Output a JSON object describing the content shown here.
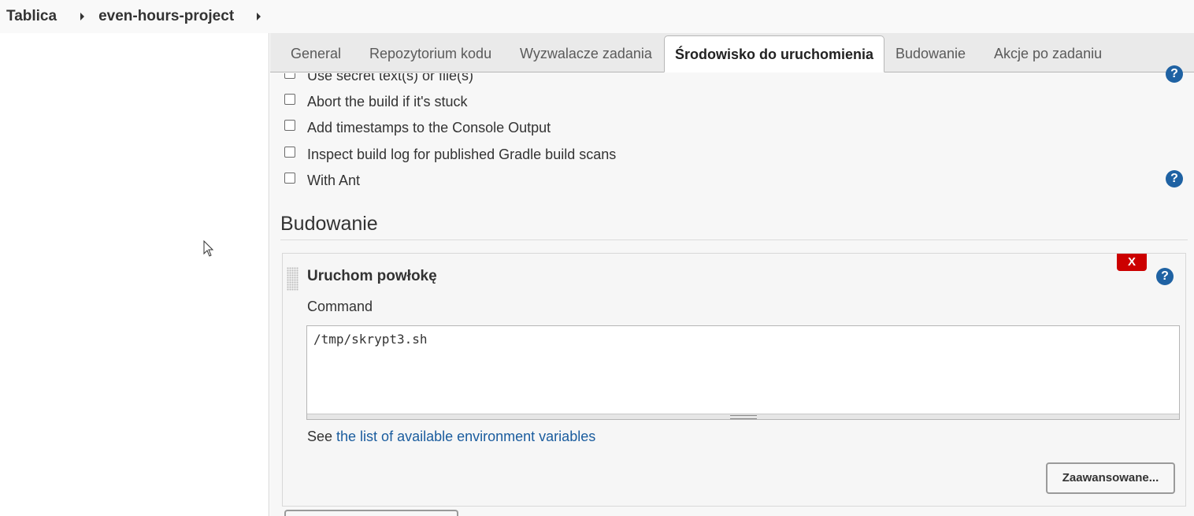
{
  "breadcrumb": {
    "items": [
      "Tablica",
      "even-hours-project"
    ]
  },
  "tabs": [
    {
      "label": "General"
    },
    {
      "label": "Repozytorium kodu"
    },
    {
      "label": "Wyzwalacze zadania"
    },
    {
      "label": "Środowisko do uruchomienia",
      "active": true
    },
    {
      "label": "Budowanie"
    },
    {
      "label": "Akcje po zadaniu"
    }
  ],
  "environment_options": [
    {
      "label": "Use secret text(s) or file(s)",
      "checked": false
    },
    {
      "label": "Abort the build if it's stuck",
      "checked": false
    },
    {
      "label": "Add timestamps to the Console Output",
      "checked": false
    },
    {
      "label": "Inspect build log for published Gradle build scans",
      "checked": false
    },
    {
      "label": "With Ant",
      "checked": false
    }
  ],
  "help_glyph": "?",
  "build_section": {
    "title": "Budowanie",
    "step": {
      "title": "Uruchom powłokę",
      "delete_label": "X",
      "command_label": "Command",
      "command_value": "/tmp/skrypt3.sh",
      "see_prefix": "See ",
      "see_link": "the list of available environment variables",
      "advanced_button": "Zaawansowane..."
    }
  },
  "colors": {
    "help_icon": "#1f62a3",
    "delete_button": "#cc0000",
    "link": "#1a5c9e"
  },
  "icons": [
    "caret-right-icon",
    "help-icon",
    "drag-handle-icon",
    "mouse-cursor-icon"
  ]
}
